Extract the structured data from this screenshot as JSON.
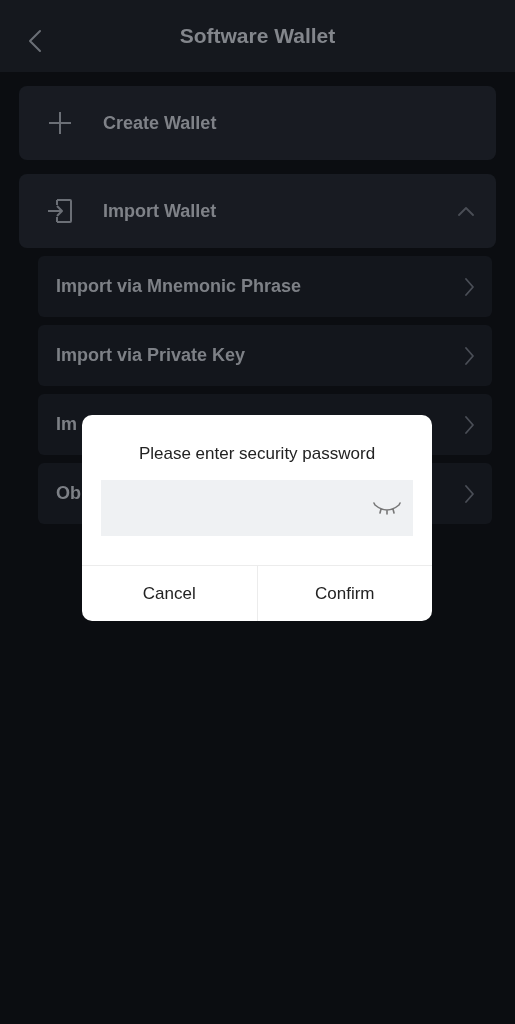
{
  "header": {
    "title": "Software Wallet"
  },
  "options": [
    {
      "kind": "create",
      "label": "Create Wallet"
    },
    {
      "kind": "import",
      "label": "Import Wallet",
      "expanded": true,
      "children": [
        {
          "label": "Import via Mnemonic Phrase"
        },
        {
          "label": "Import via Private Key"
        },
        {
          "label": "Im"
        },
        {
          "label": "Ob"
        }
      ]
    }
  ],
  "dialog": {
    "title": "Please enter security password",
    "password_visible": false,
    "buttons": [
      "Cancel",
      "Confirm"
    ]
  }
}
